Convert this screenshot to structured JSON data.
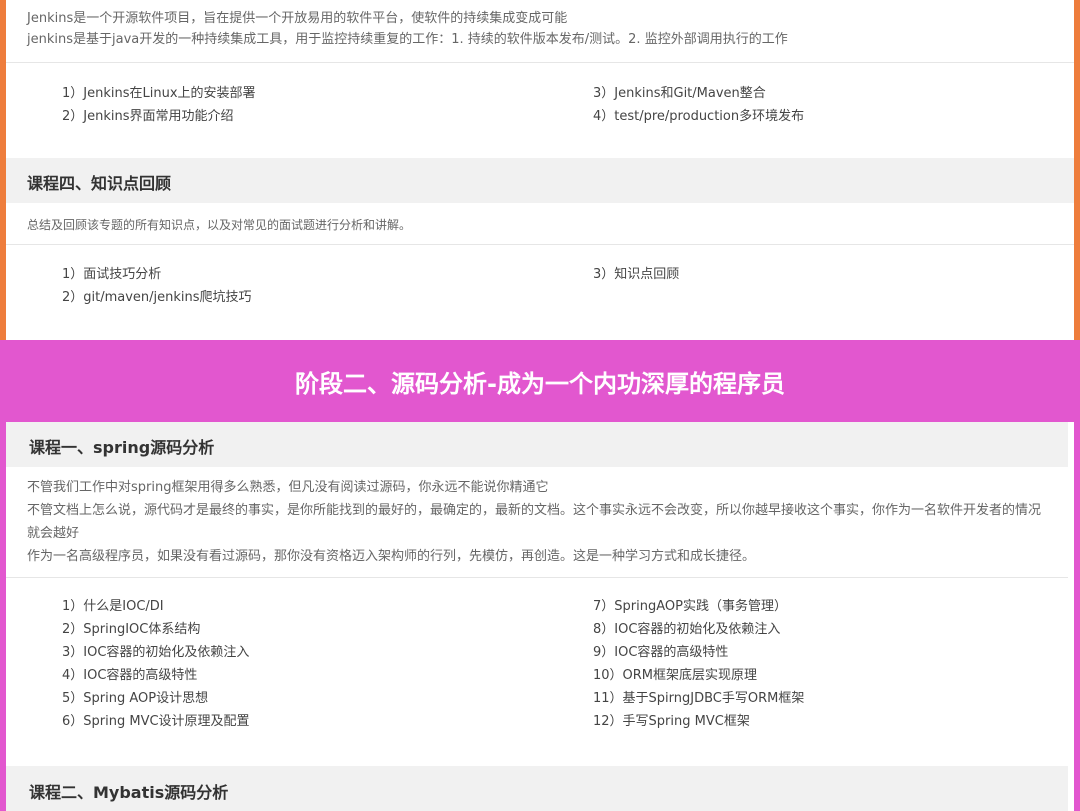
{
  "jenkins": {
    "desc": [
      "Jenkins是一个开源软件项目，旨在提供一个开放易用的软件平台，使软件的持续集成变成可能",
      "jenkins是基于java开发的一种持续集成工具，用于监控持续重复的工作：1. 持续的软件版本发布/测试。2. 监控外部调用执行的工作"
    ],
    "left": [
      "1）Jenkins在Linux上的安装部署",
      "2）Jenkins界面常用功能介绍"
    ],
    "right": [
      "3）Jenkins和Git/Maven整合",
      "4）test/pre/production多环境发布"
    ]
  },
  "course4": {
    "title": "课程四、知识点回顾",
    "desc": "总结及回顾该专题的所有知识点，以及对常见的面试题进行分析和讲解。",
    "left": [
      "1）面试技巧分析",
      "2）git/maven/jenkins爬坑技巧"
    ],
    "right": [
      "3）知识点回顾"
    ]
  },
  "stage2": {
    "title": "阶段二、源码分析-成为一个内功深厚的程序员"
  },
  "spring": {
    "title": "课程一、spring源码分析",
    "desc": [
      "不管我们工作中对spring框架用得多么熟悉，但凡没有阅读过源码，你永远不能说你精通它",
      "不管文档上怎么说，源代码才是最终的事实，是你所能找到的最好的，最确定的，最新的文档。这个事实永远不会改变，所以你越早接收这个事实，你作为一名软件开发者的情况就会越好",
      "作为一名高级程序员，如果没有看过源码，那你没有资格迈入架构师的行列，先模仿，再创造。这是一种学习方式和成长捷径。"
    ],
    "left": [
      "1）什么是IOC/DI",
      "2）SpringIOC体系结构",
      "3）IOC容器的初始化及依赖注入",
      "4）IOC容器的高级特性",
      "5）Spring AOP设计思想",
      "6）Spring MVC设计原理及配置"
    ],
    "right": [
      "7）SpringAOP实践（事务管理）",
      "8）IOC容器的初始化及依赖注入",
      "9）IOC容器的高级特性",
      "10）ORM框架底层实现原理",
      "11）基于SpirngJDBC手写ORM框架",
      "12）手写Spring MVC框架"
    ]
  },
  "mybatis": {
    "title": "课程二、Mybatis源码分析"
  }
}
